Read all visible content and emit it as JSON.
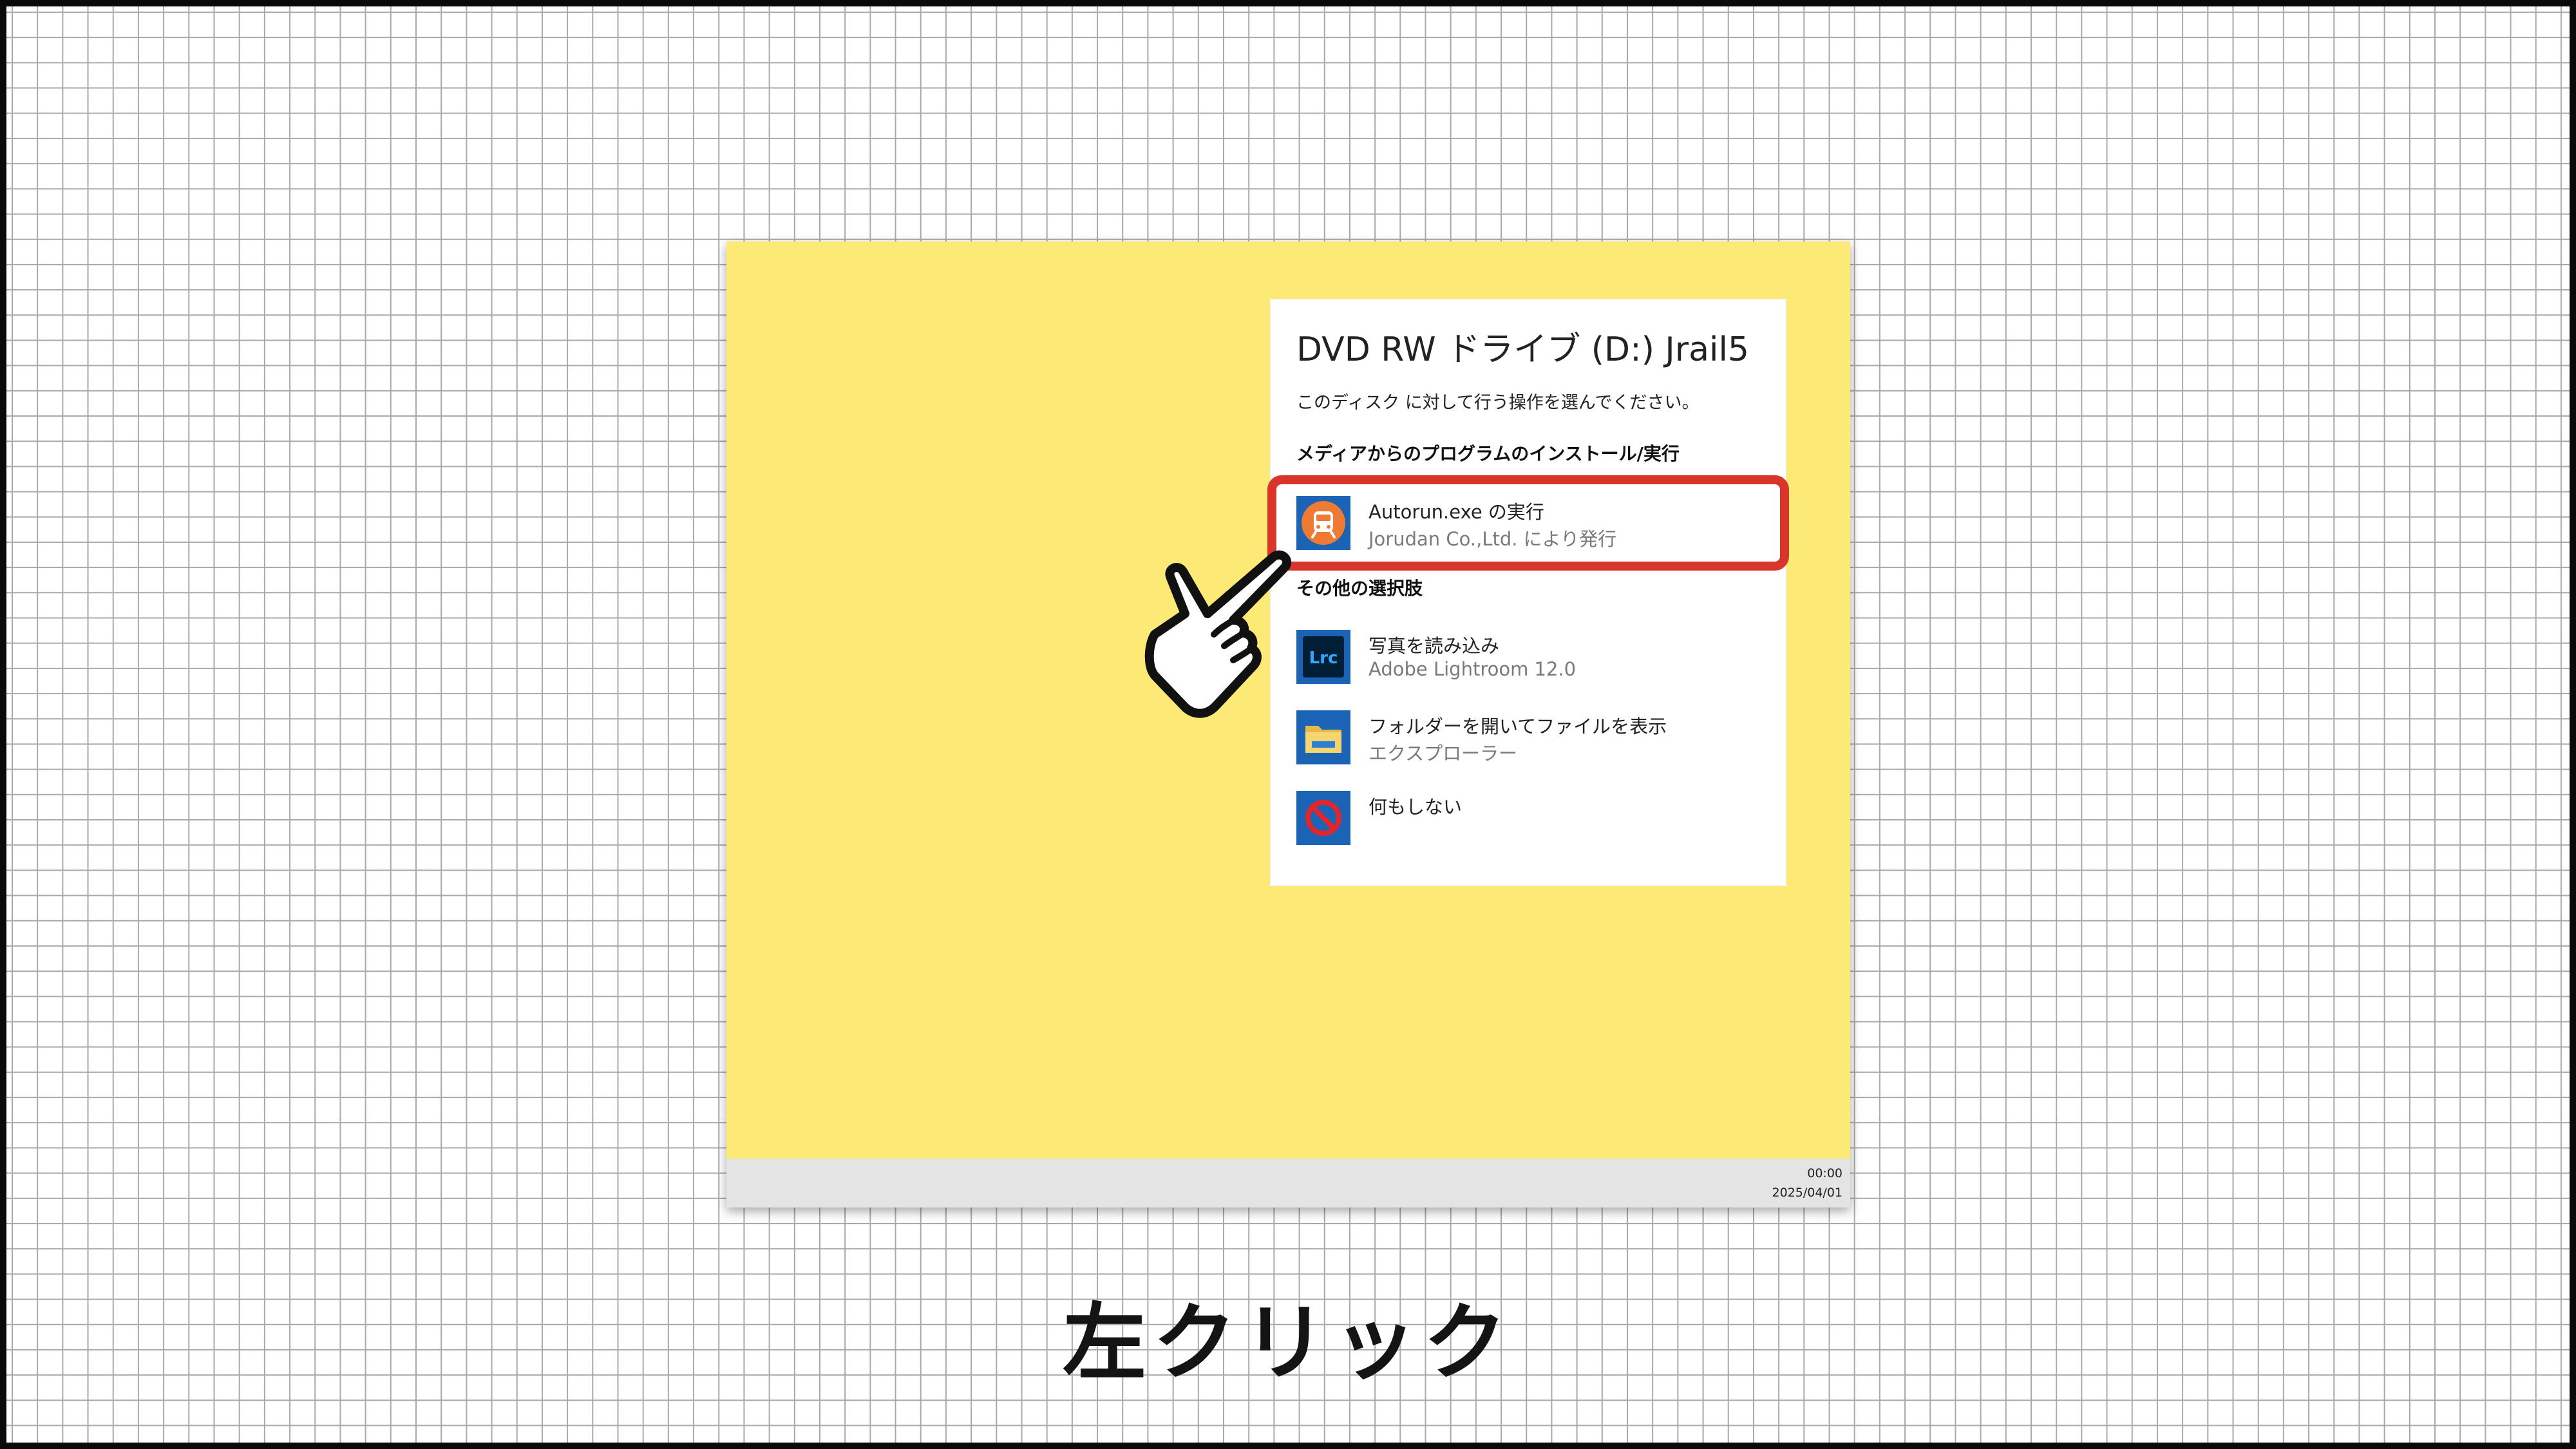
{
  "dialog": {
    "title": "DVD RW ドライブ (D:) Jrail5",
    "subtitle": "このディスク に対して行う操作を選んでください。",
    "section_install": "メディアからのプログラムのインストール/実行",
    "section_other": "その他の選択肢",
    "options": [
      {
        "line1": "Autorun.exe の実行",
        "line2": "Jorudan Co.,Ltd. により発行",
        "icon": "train-icon"
      },
      {
        "line1": "写真を読み込み",
        "line2": "Adobe Lightroom 12.0",
        "icon": "lightroom-icon",
        "icon_text": "Lrc"
      },
      {
        "line1": "フォルダーを開いてファイルを表示",
        "line2": "エクスプローラー",
        "icon": "folder-icon"
      },
      {
        "line1": "何もしない",
        "line2": "",
        "icon": "prohibited-icon"
      }
    ]
  },
  "taskbar": {
    "time": "00:00",
    "date": "2025/04/01"
  },
  "caption": "左クリック",
  "colors": {
    "desktop": "#fdea76",
    "highlight": "#d8352b",
    "icon_bg": "#1a63b5"
  }
}
